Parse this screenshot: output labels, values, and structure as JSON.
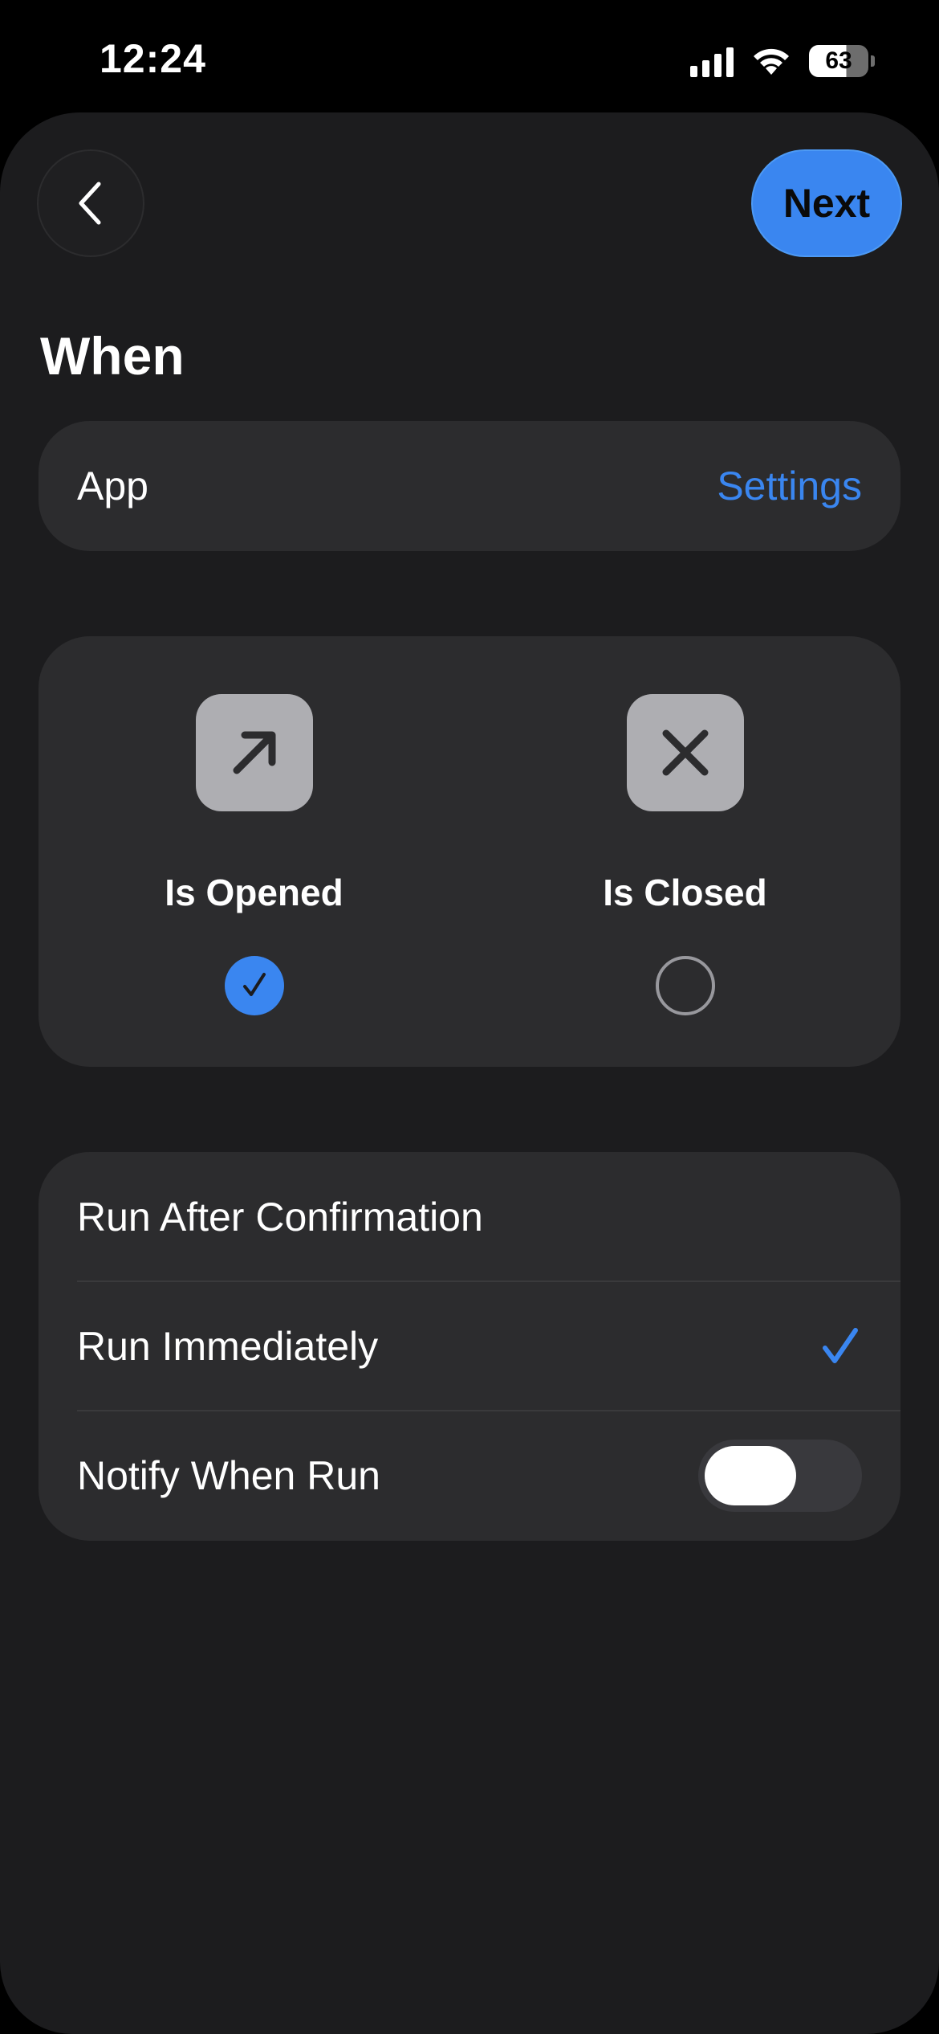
{
  "status_bar": {
    "time": "12:24",
    "battery": "63",
    "icons": [
      "signal-icon",
      "wifi-icon",
      "battery-icon"
    ]
  },
  "header": {
    "back_icon": "chevron-left-icon",
    "next_label": "Next"
  },
  "section": {
    "title": "When"
  },
  "app_row": {
    "label": "App",
    "value": "Settings"
  },
  "choices": [
    {
      "label": "Is Opened",
      "icon": "arrow-up-right-icon",
      "selected": true
    },
    {
      "label": "Is Closed",
      "icon": "x-mark-icon",
      "selected": false
    }
  ],
  "options": {
    "run_after_confirmation": "Run After Confirmation",
    "run_immediately": "Run Immediately",
    "run_immediately_checked": true,
    "notify_when_run": "Notify When Run",
    "notify_toggle_on": false
  },
  "colors": {
    "accent": "#3a86f0",
    "background": "#1c1c1e",
    "card": "#2c2c2e"
  }
}
